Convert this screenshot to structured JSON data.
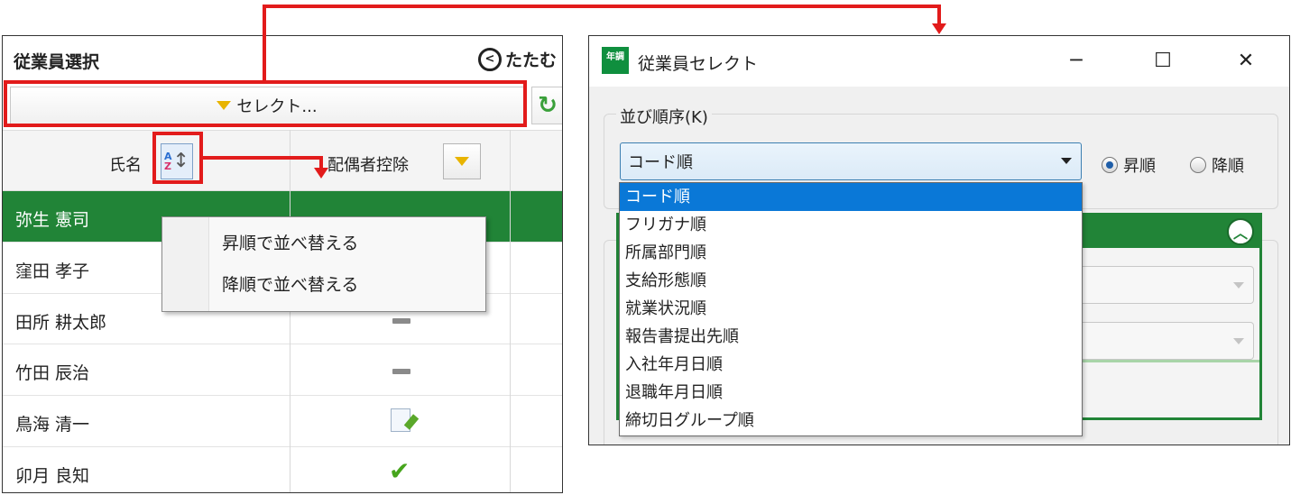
{
  "left_panel": {
    "title": "従業員選択",
    "collapse_label": "たたむ",
    "select_button_label": "セレクト...",
    "columns": {
      "name": "氏名",
      "spouse": "配偶者控除"
    },
    "rows": [
      {
        "name": "弥生 憲司",
        "status": ""
      },
      {
        "name": "窪田 孝子",
        "status": ""
      },
      {
        "name": "田所 耕太郎",
        "status": "dash"
      },
      {
        "name": "竹田 辰治",
        "status": "dash"
      },
      {
        "name": "鳥海 清一",
        "status": "memo"
      },
      {
        "name": "卯月 良知",
        "status": "check"
      }
    ],
    "sort_menu": {
      "ascending": "昇順で並べ替える",
      "descending": "降順で並べ替える"
    }
  },
  "window": {
    "app_icon_text": "年調",
    "title": "従業員セレクト",
    "group_sort_label": "並び順序(K)",
    "combo_value": "コード順",
    "radio_ascending": "昇順",
    "radio_descending": "降順",
    "dropdown_options": [
      "コード順",
      "フリガナ順",
      "所属部門順",
      "支給形態順",
      "就業状況順",
      "報告書提出先順",
      "入社年月日順",
      "退職年月日順",
      "締切日グループ順"
    ]
  },
  "colors": {
    "accent_green": "#218437",
    "annotation_red": "#e21b1b",
    "selection_blue": "#0a78d7"
  }
}
